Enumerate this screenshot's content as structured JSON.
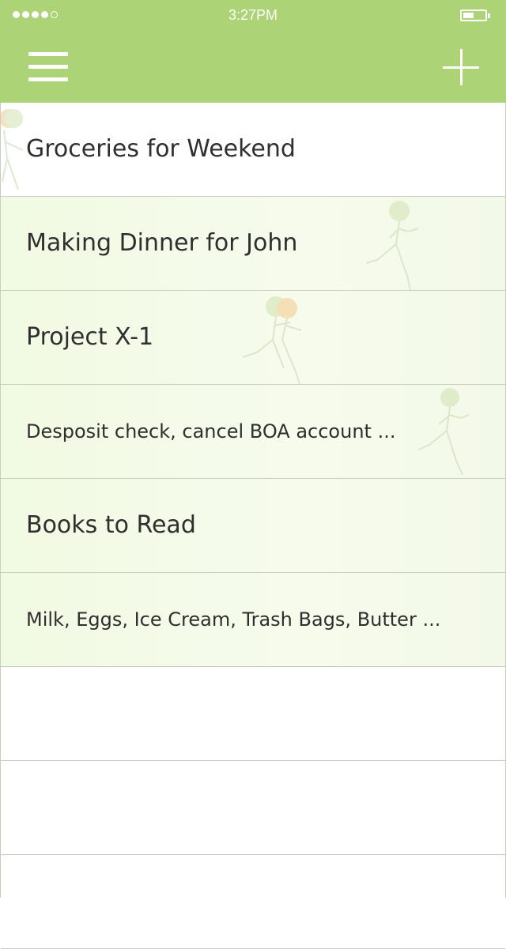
{
  "status_bar": {
    "time": "3:27PM",
    "signal_filled": 4,
    "signal_total": 5,
    "battery_level": 0.45
  },
  "colors": {
    "header": "#acd375",
    "row_tint": "#f1fae3",
    "divider": "#c9cfc0",
    "text": "#2f2f2f"
  },
  "header": {
    "menu_icon": "hamburger-menu-icon",
    "add_icon": "plus-icon"
  },
  "lists": [
    {
      "title": "Groceries for Weekend"
    },
    {
      "title": "Making Dinner for John"
    },
    {
      "title": "Project X-1"
    },
    {
      "title": "Desposit check, cancel BOA account ..."
    },
    {
      "title": "Books to Read"
    },
    {
      "title": "Milk, Eggs, Ice Cream, Trash Bags, Butter ..."
    }
  ],
  "empty_rows": 3
}
